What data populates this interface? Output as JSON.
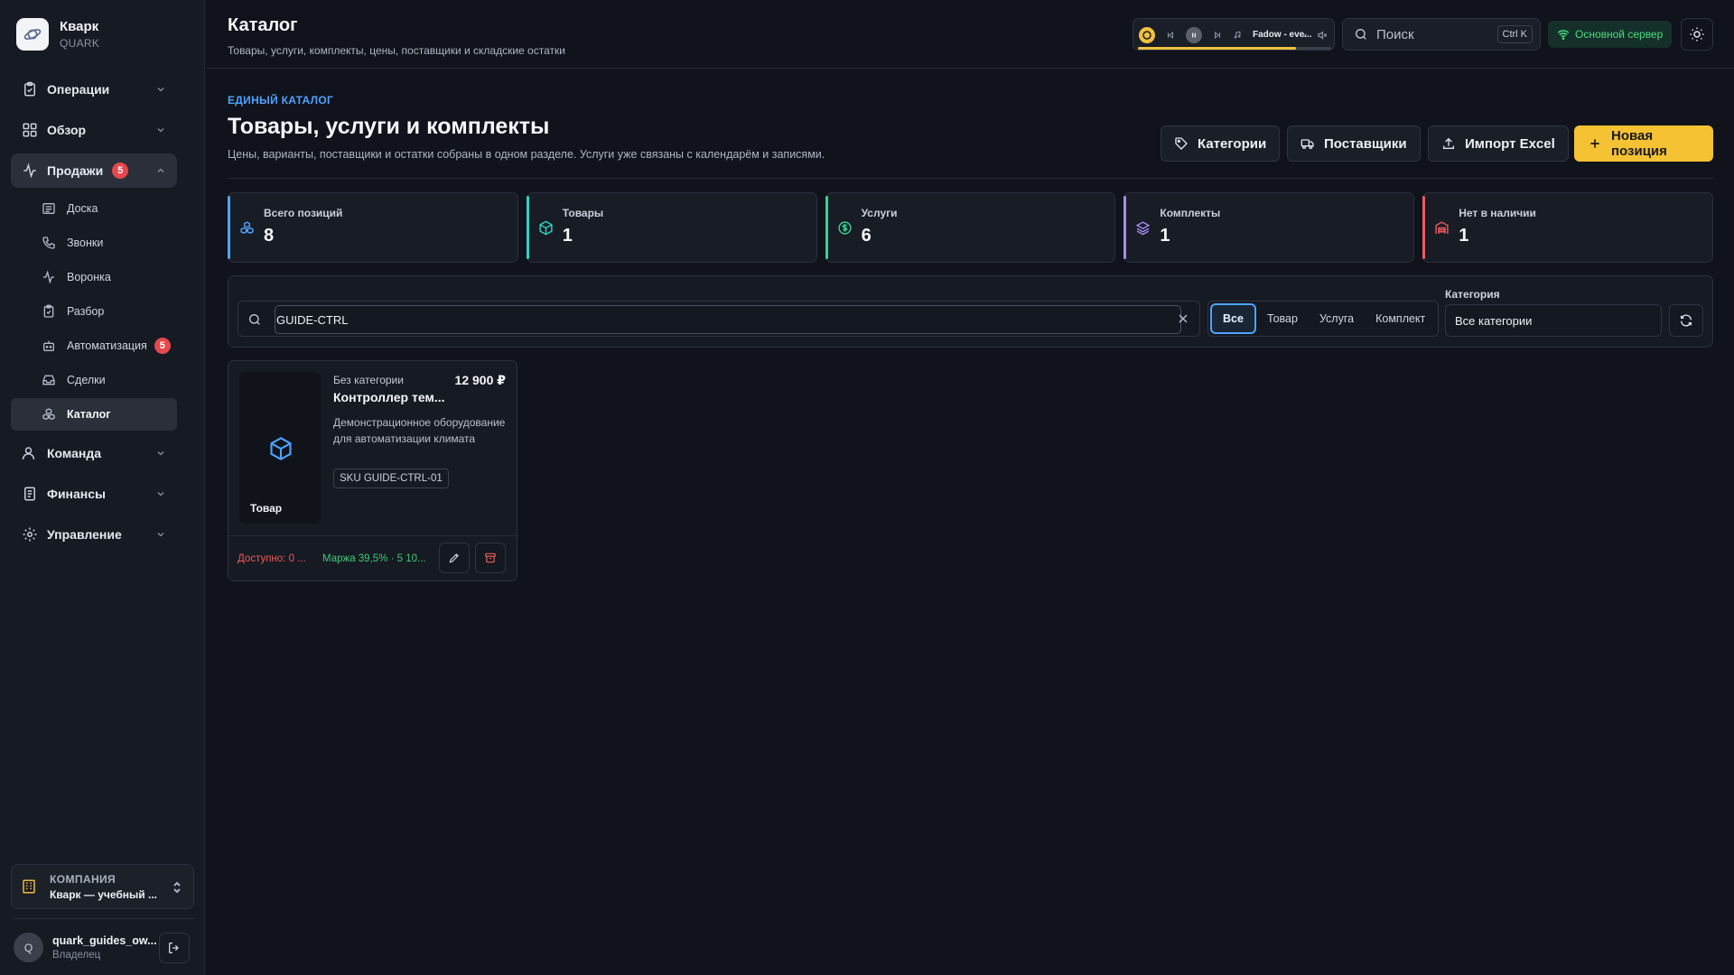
{
  "app": {
    "name": "Кварк",
    "sub": "QUARK"
  },
  "sidebar": {
    "items": [
      {
        "label": "Операции"
      },
      {
        "label": "Обзор"
      },
      {
        "label": "Продажи",
        "badge": "5"
      },
      {
        "label": "Команда"
      },
      {
        "label": "Финансы"
      },
      {
        "label": "Управление"
      }
    ],
    "sales_sub": [
      {
        "label": "Доска"
      },
      {
        "label": "Звонки"
      },
      {
        "label": "Воронка"
      },
      {
        "label": "Разбор"
      },
      {
        "label": "Автоматизация",
        "badge": "5"
      },
      {
        "label": "Сделки"
      },
      {
        "label": "Каталог"
      }
    ],
    "company": {
      "caption": "КОМПАНИЯ",
      "name": "Кварк — учебный ..."
    },
    "user": {
      "initial": "Q",
      "name": "quark_guides_ow...",
      "role": "Владелец"
    }
  },
  "topbar": {
    "title": "Каталог",
    "subtitle": "Товары, услуги, комплекты, цены, поставщики и складские остатки",
    "player": {
      "track": "Fadow - eve...",
      "progress": 0.82
    },
    "search_placeholder": "Поиск",
    "shortcut": "Ctrl K",
    "server": "Основной сервер"
  },
  "page": {
    "eyebrow": "ЕДИНЫЙ КАТАЛОГ",
    "title": "Товары, услуги и комплекты",
    "lead": "Цены, варианты, поставщики и остатки собраны в одном разделе. Услуги уже связаны с календарём и записями.",
    "buttons": {
      "categories": "Категории",
      "suppliers": "Поставщики",
      "import": "Импорт Excel",
      "new_item": "Новая позиция"
    }
  },
  "stats": [
    {
      "label": "Всего позиций",
      "value": "8"
    },
    {
      "label": "Товары",
      "value": "1"
    },
    {
      "label": "Услуги",
      "value": "6"
    },
    {
      "label": "Комплекты",
      "value": "1"
    },
    {
      "label": "Нет в наличии",
      "value": "1"
    }
  ],
  "filters": {
    "search_value": "GUIDE-CTRL",
    "types": [
      "Все",
      "Товар",
      "Услуга",
      "Комплект"
    ],
    "active_type": "Все",
    "category_label": "Категория",
    "category_value": "Все категории"
  },
  "product": {
    "type": "Товар",
    "category": "Без категории",
    "price": "12 900 ₽",
    "name": "Контроллер тем...",
    "description": "Демонстрационное оборудование для автоматизации климата",
    "sku": "SKU GUIDE-CTRL-01",
    "available": "Доступно: 0 ...",
    "margin": "Маржа 39,5% · 5 10..."
  },
  "colors": {
    "accent_blue": "#4ea3ff",
    "accent_yellow": "#f4c233",
    "danger": "#e5484d",
    "success": "#3fc97a"
  }
}
